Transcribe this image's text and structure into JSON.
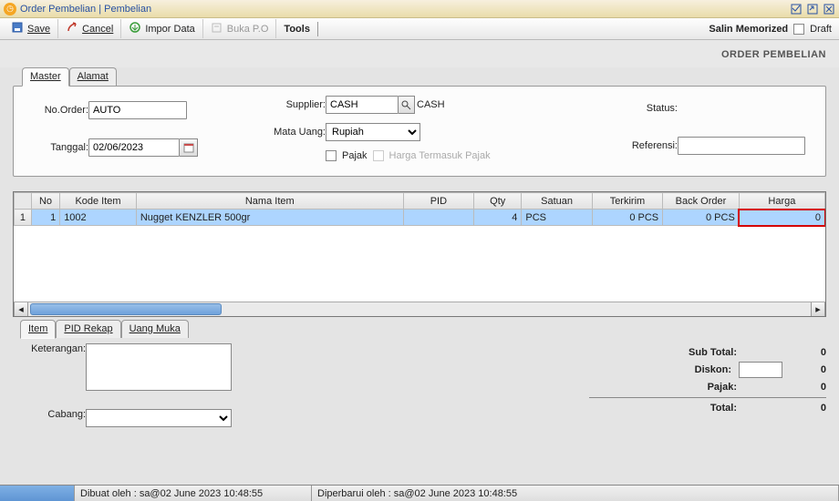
{
  "window": {
    "title": "Order Pembelian | Pembelian"
  },
  "toolbar": {
    "save": "Save",
    "cancel": "Cancel",
    "import": "Impor Data",
    "bukapo": "Buka P.O",
    "tools": "Tools",
    "salin": "Salin Memorized",
    "draft": "Draft"
  },
  "page_title": "ORDER PEMBELIAN",
  "tabs_top": {
    "master": "Master",
    "alamat": "Alamat"
  },
  "form": {
    "noorder_label": "No.Order:",
    "noorder_value": "AUTO",
    "tanggal_label": "Tanggal:",
    "tanggal_value": "02/06/2023",
    "supplier_label": "Supplier:",
    "supplier_value": "CASH",
    "supplier_name": "CASH",
    "matauang_label": "Mata Uang:",
    "matauang_value": "Rupiah",
    "pajak_label": "Pajak",
    "hargatermasuk_label": "Harga Termasuk Pajak",
    "status_label": "Status:",
    "referensi_label": "Referensi:",
    "referensi_value": ""
  },
  "grid": {
    "cols": {
      "no": "No",
      "kode": "Kode Item",
      "nama": "Nama Item",
      "pid": "PID",
      "qty": "Qty",
      "satuan": "Satuan",
      "terkirim": "Terkirim",
      "backorder": "Back Order",
      "harga": "Harga"
    },
    "rows": [
      {
        "rownum": "1",
        "no": "1",
        "kode": "1002",
        "nama": "Nugget KENZLER 500gr",
        "pid": "",
        "qty": "4",
        "satuan": "PCS",
        "terkirim": "0 PCS",
        "backorder": "0 PCS",
        "harga": "0"
      }
    ]
  },
  "tabs_bottom": {
    "item": "Item",
    "pidrekap": "PID Rekap",
    "uangmuka": "Uang Muka"
  },
  "bottom": {
    "keterangan_label": "Keterangan:",
    "keterangan_value": "",
    "cabang_label": "Cabang:",
    "cabang_value": ""
  },
  "totals": {
    "subtotal_label": "Sub Total:",
    "subtotal_value": "0",
    "diskon_label": "Diskon:",
    "diskon_pct": "",
    "diskon_value": "0",
    "pajak_label": "Pajak:",
    "pajak_value": "0",
    "total_label": "Total:",
    "total_value": "0"
  },
  "status": {
    "created": "Dibuat oleh : sa@02 June 2023  10:48:55",
    "updated": "Diperbarui oleh : sa@02 June 2023  10:48:55"
  },
  "chart_data": null
}
